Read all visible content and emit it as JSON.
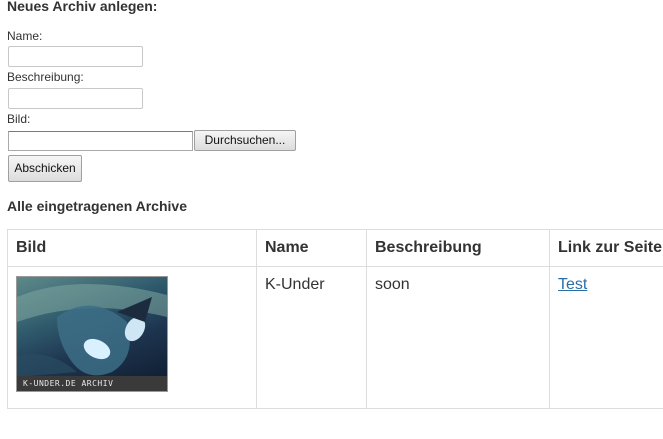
{
  "form": {
    "heading": "Neues Archiv anlegen:",
    "name_label": "Name:",
    "name_value": "",
    "description_label": "Beschreibung:",
    "description_value": "",
    "image_label": "Bild:",
    "image_value": "",
    "browse_label": "Durchsuchen...",
    "submit_label": "Abschicken"
  },
  "archive_list": {
    "heading": "Alle eingetragenen Archive",
    "columns": [
      "Bild",
      "Name",
      "Beschreibung",
      "Link zur Seite"
    ],
    "rows": [
      {
        "image_caption": "K-UNDER.DE ARCHIV",
        "name": "K-Under",
        "description": "soon",
        "link_text": "Test"
      }
    ]
  },
  "colors": {
    "link": "#2a6ea8",
    "border": "#dddddd",
    "text": "#333333"
  }
}
